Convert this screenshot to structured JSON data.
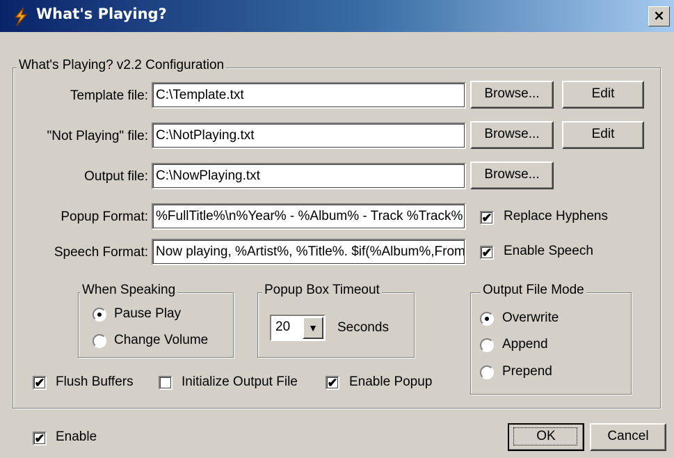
{
  "window": {
    "title": "What's Playing?",
    "close_glyph": "×",
    "icon": "lightning-bolt-icon"
  },
  "config_group": {
    "legend": "What's Playing? v2.2 Configuration"
  },
  "template_file": {
    "label": "Template file:",
    "value": "C:\\Template.txt",
    "browse": "Browse...",
    "edit": "Edit"
  },
  "not_playing_file": {
    "label": "\"Not Playing\" file:",
    "value": "C:\\NotPlaying.txt",
    "browse": "Browse...",
    "edit": "Edit"
  },
  "output_file": {
    "label": "Output file:",
    "value": "C:\\NowPlaying.txt",
    "browse": "Browse..."
  },
  "popup_format": {
    "label": "Popup Format:",
    "value": "%FullTitle%\\n%Year% - %Album% - Track %Track%",
    "checkbox": "Replace Hyphens",
    "checked": true
  },
  "speech_format": {
    "label": "Speech Format:",
    "value": "Now playing, %Artist%, %Title%. $if(%Album%,From the album %Album%)",
    "checkbox": "Enable Speech",
    "checked": true
  },
  "when_speaking": {
    "legend": "When Speaking",
    "options": [
      "Pause Play",
      "Change Volume"
    ],
    "selected": "Pause Play"
  },
  "popup_timeout": {
    "legend": "Popup Box Timeout",
    "value": "20",
    "unit": "Seconds"
  },
  "output_mode": {
    "legend": "Output File Mode",
    "options": [
      "Overwrite",
      "Append",
      "Prepend"
    ],
    "selected": "Overwrite"
  },
  "flush_buffers": {
    "label": "Flush Buffers",
    "checked": true
  },
  "init_output": {
    "label": "Initialize Output File",
    "checked": false
  },
  "enable_popup": {
    "label": "Enable Popup",
    "checked": true
  },
  "enable": {
    "label": "Enable",
    "checked": true
  },
  "ok": "OK",
  "cancel": "Cancel",
  "check_glyph": "✔"
}
